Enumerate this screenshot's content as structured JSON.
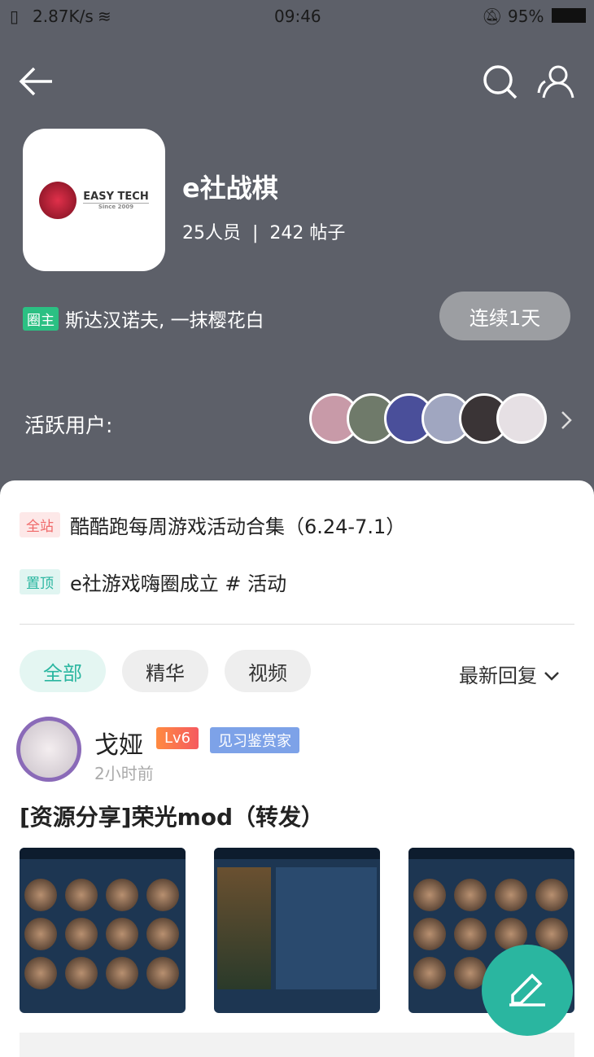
{
  "status_bar": {
    "speed": "2.87K/s",
    "time": "09:46",
    "battery": "95%"
  },
  "header": {
    "icons": [
      "back-arrow-icon",
      "search-icon",
      "members-icon"
    ]
  },
  "circle": {
    "name": "e社战棋",
    "logo_text": "EASY TECH",
    "logo_sub": "Since 2009",
    "members": "25人员",
    "separator": "|",
    "posts": "242 帖子",
    "owner_tag": "圈主",
    "owners": "斯达汉诺夫, 一抹樱花白",
    "streak": "连续1天",
    "active_label": "活跃用户:"
  },
  "notices": [
    {
      "tag": "全站",
      "text": "酷酷跑每周游戏活动合集（6.24-7.1）",
      "tag_color": "#f06a6a"
    },
    {
      "tag": "置顶",
      "text": "e社游戏嗨圈成立 # 活动",
      "tag_color": "#2ab6a0"
    }
  ],
  "filters": {
    "chips": [
      "全部",
      "精华",
      "视频"
    ],
    "sort": "最新回复"
  },
  "post": {
    "author": "戈娅",
    "level": "Lv6",
    "badge": "见习鉴赏家",
    "time": "2小时前",
    "title": "[资源分享]荣光mod（转发）"
  },
  "colors": {
    "accent": "#2ab6a0",
    "header_bg": "#5d6069"
  }
}
